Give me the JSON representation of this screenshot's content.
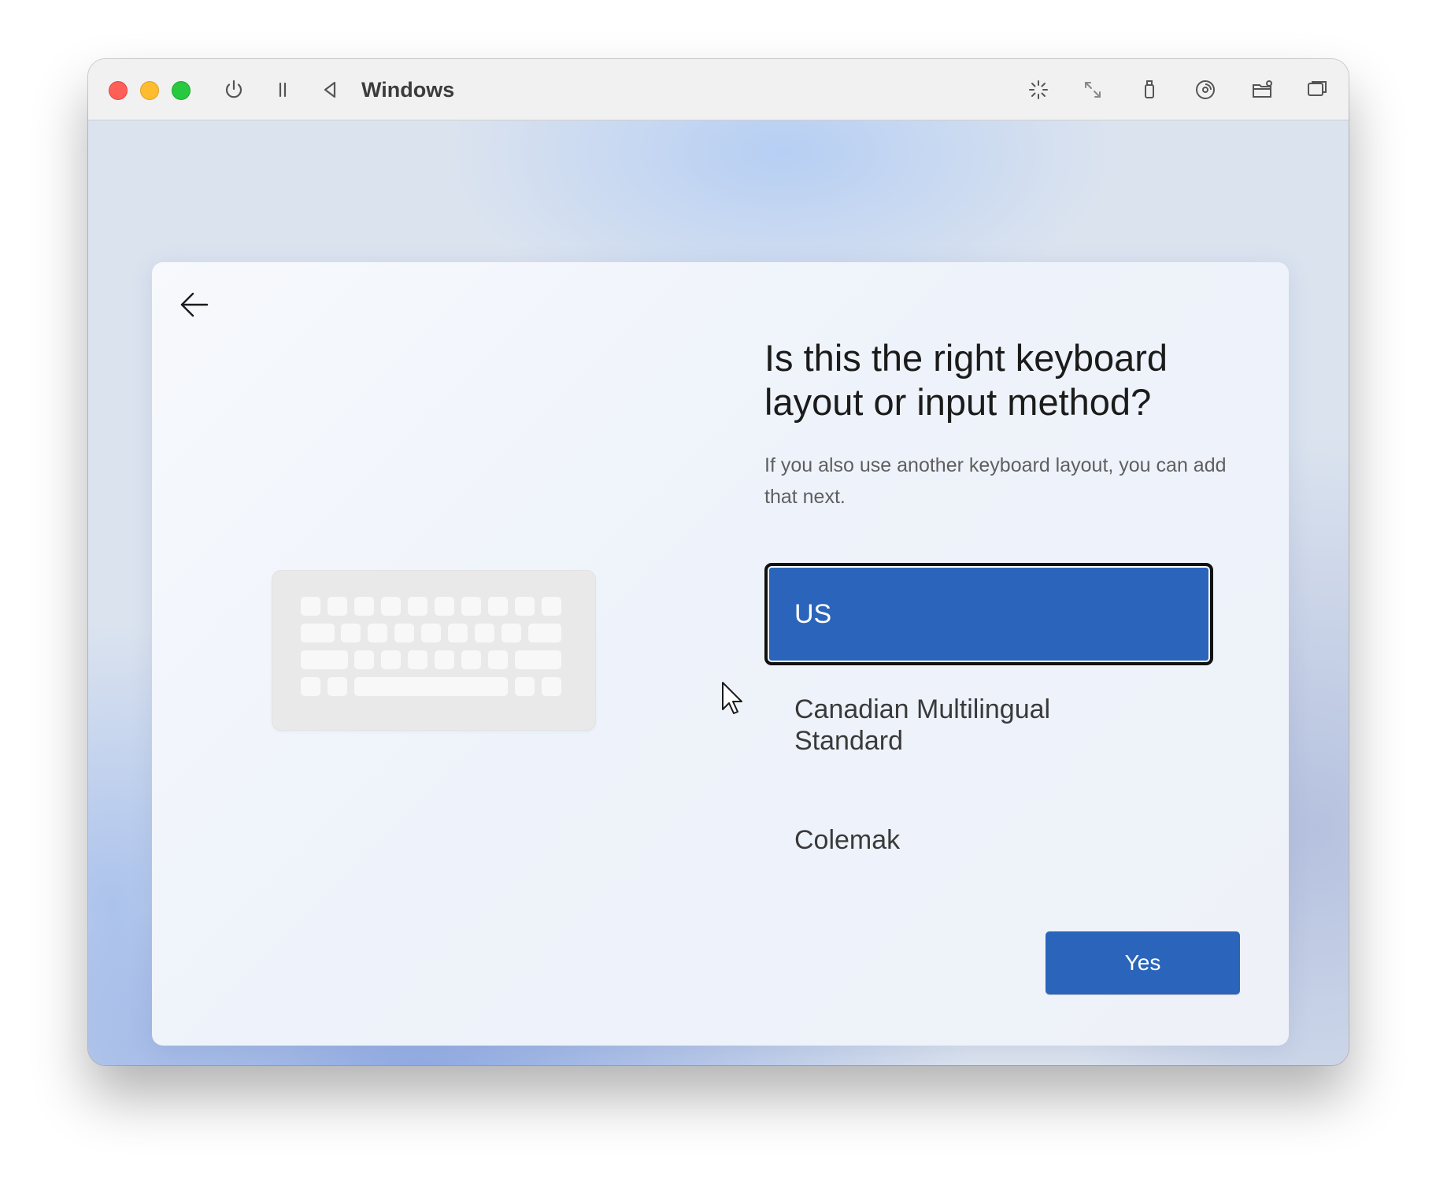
{
  "window": {
    "title": "Windows",
    "toolbar_icons": [
      "power-icon",
      "pause-icon",
      "back-triangle-icon",
      "brightness-icon",
      "resize-icon",
      "usb-icon",
      "disc-icon",
      "shared-folder-icon",
      "window-icon"
    ]
  },
  "setup": {
    "heading": "Is this the right keyboard layout or input method?",
    "subtitle": "If you also use another keyboard layout, you can add that next.",
    "options": [
      {
        "label": "US",
        "selected": true
      },
      {
        "label": "Canadian Multilingual Standard",
        "selected": false
      },
      {
        "label": "Colemak",
        "selected": false
      }
    ],
    "yes_label": "Yes"
  },
  "colors": {
    "accent": "#2b65bb",
    "traffic_red": "#fe5f57",
    "traffic_yellow": "#febc2e",
    "traffic_green": "#28c840"
  },
  "footer_icons": [
    "accessibility-icon",
    "volume-icon"
  ]
}
